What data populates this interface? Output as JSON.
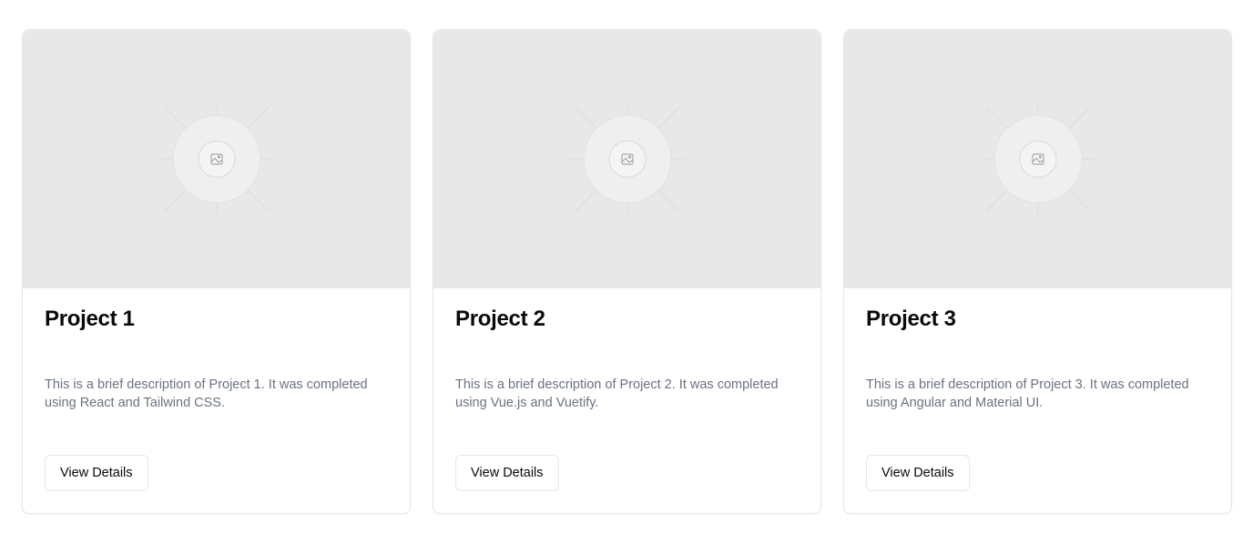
{
  "projects": [
    {
      "title": "Project 1",
      "description": "This is a brief description of Project 1. It was completed using React and Tailwind CSS.",
      "button_label": "View Details",
      "image_icon": "image-placeholder-icon"
    },
    {
      "title": "Project 2",
      "description": "This is a brief description of Project 2. It was completed using Vue.js and Vuetify.",
      "button_label": "View Details",
      "image_icon": "image-placeholder-icon"
    },
    {
      "title": "Project 3",
      "description": "This is a brief description of Project 3. It was completed using Angular and Material UI.",
      "button_label": "View Details",
      "image_icon": "image-placeholder-icon"
    }
  ],
  "colors": {
    "thumbnail_bg": "#e8e8e8",
    "title": "#0a0a0a",
    "description": "#6b7280",
    "border": "#e5e7eb"
  }
}
